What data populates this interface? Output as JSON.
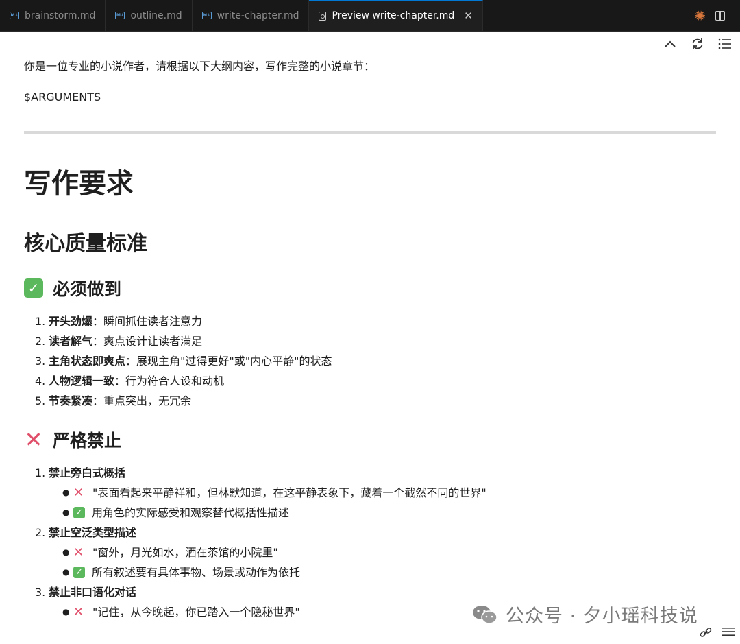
{
  "tabs": [
    {
      "label": "brainstorm.md",
      "icon": "markdown-icon",
      "active": false
    },
    {
      "label": "outline.md",
      "icon": "markdown-icon",
      "active": false
    },
    {
      "label": "write-chapter.md",
      "icon": "markdown-icon",
      "active": false
    },
    {
      "label": "Preview write-chapter.md",
      "icon": "preview-icon",
      "active": true
    }
  ],
  "doc": {
    "intro": "你是一位专业的小说作者，请根据以下大纲内容，写作完整的小说章节：",
    "args": "$ARGUMENTS",
    "h1": "写作要求",
    "h2": "核心质量标准",
    "must_title": "必须做到",
    "must_items": [
      {
        "num": "1.",
        "bold": "开头劲爆",
        "text": "：瞬间抓住读者注意力"
      },
      {
        "num": "2.",
        "bold": "读者解气",
        "text": "：爽点设计让读者满足"
      },
      {
        "num": "3.",
        "bold": "主角状态即爽点",
        "text": "：展现主角\"过得更好\"或\"内心平静\"的状态"
      },
      {
        "num": "4.",
        "bold": "人物逻辑一致",
        "text": "：行为符合人设和动机"
      },
      {
        "num": "5.",
        "bold": "节奏紧凑",
        "text": "：重点突出，无冗余"
      }
    ],
    "forbid_title": "严格禁止",
    "forbid_items": [
      {
        "num": "1.",
        "bold": "禁止旁白式概括",
        "bad": "\"表面看起来平静祥和，但林默知道，在这平静表象下，藏着一个截然不同的世界\"",
        "good": "用角色的实际感受和观察替代概括性描述"
      },
      {
        "num": "2.",
        "bold": "禁止空泛类型描述",
        "bad": "\"窗外，月光如水，洒在茶馆的小院里\"",
        "good": "所有叙述要有具体事物、场景或动作为依托"
      },
      {
        "num": "3.",
        "bold": "禁止非口语化对话",
        "bad": "\"记住，从今晚起，你已踏入一个隐秘世界\""
      }
    ]
  },
  "watermark": "公众号 · 夕小瑶科技说"
}
